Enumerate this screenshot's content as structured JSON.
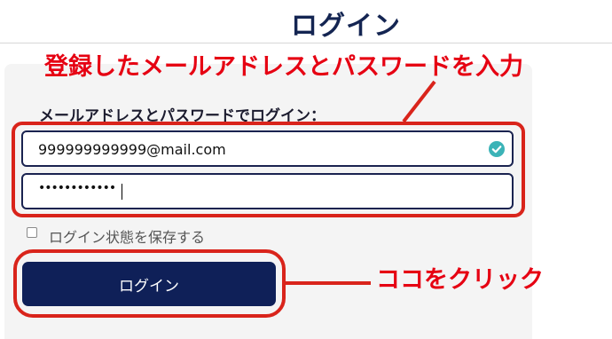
{
  "header": {
    "title": "ログイン"
  },
  "form": {
    "label": "メールアドレスとパスワードでログイン：",
    "email_value": "999999999999@mail.com",
    "password_value": "••••••••••••",
    "remember_label": "ログイン状態を保存する",
    "remember_checked": false,
    "submit_label": "ログイン"
  },
  "annotations": {
    "inputs_note": "登録したメールアドレスとパスワードを入力",
    "button_note": "ココをクリック"
  },
  "colors": {
    "brand_navy": "#0f2058",
    "annotation_red": "#d9241b",
    "valid_check": "#3bb3b7"
  },
  "icons": {
    "email_status": "check-circle-icon"
  }
}
